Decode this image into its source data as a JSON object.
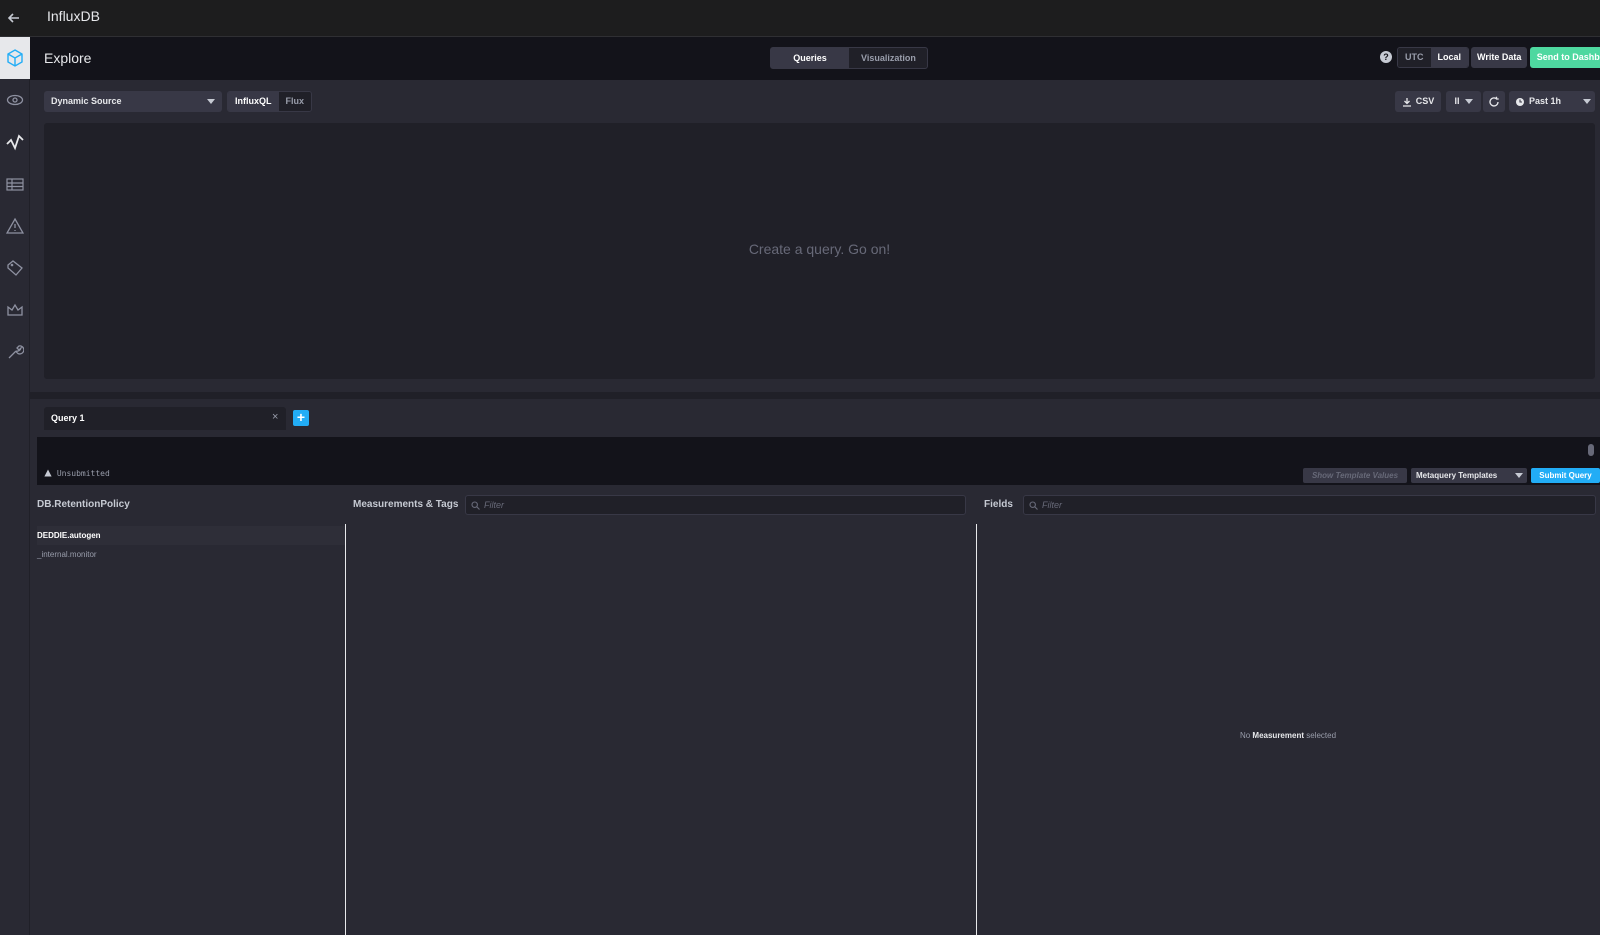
{
  "app": {
    "title": "InfluxDB"
  },
  "sidenav": {
    "items": [
      {
        "name": "status-icon",
        "active": true
      },
      {
        "name": "host-list-icon",
        "active": false
      },
      {
        "name": "data-explorer-icon",
        "active": false
      },
      {
        "name": "dashboards-icon",
        "active": false
      },
      {
        "name": "alerting-icon",
        "active": false
      },
      {
        "name": "log-viewer-icon",
        "active": false
      },
      {
        "name": "admin-icon",
        "active": false
      },
      {
        "name": "configuration-icon",
        "active": false
      }
    ]
  },
  "header": {
    "title": "Explore",
    "tabs": {
      "queries": "Queries",
      "visualization": "Visualization"
    },
    "help": "?",
    "tz": {
      "utc": "UTC",
      "local": "Local"
    },
    "write_data": "Write Data",
    "send_to_dashboard": "Send to Dashboard"
  },
  "toolbar": {
    "source": "Dynamic Source",
    "lang": {
      "influxql": "InfluxQL",
      "flux": "Flux"
    },
    "csv": "CSV",
    "pause": "II",
    "range": "Past 1h"
  },
  "graph": {
    "empty_message": "Create a query. Go on!"
  },
  "query": {
    "tab_label": "Query 1",
    "close": "×",
    "add": "+",
    "status": "Unsubmitted",
    "show_template_values": "Show Template Values",
    "metaquery_templates": "Metaquery Templates",
    "submit": "Submit Query"
  },
  "schema": {
    "db_header": "DB.RetentionPolicy",
    "databases": [
      "DEDDIE.autogen",
      "_internal.monitor"
    ],
    "measurements_header": "Measurements & Tags",
    "measurements_filter_placeholder": "Filter",
    "fields_header": "Fields",
    "fields_filter_placeholder": "Filter",
    "no_measurement": {
      "prefix": "No",
      "bold": "Measurement",
      "suffix": "selected"
    }
  },
  "colors": {
    "accent_green": "#4ed8a0",
    "accent_blue": "#22adf6",
    "background": "#292933",
    "panel": "#202028"
  }
}
